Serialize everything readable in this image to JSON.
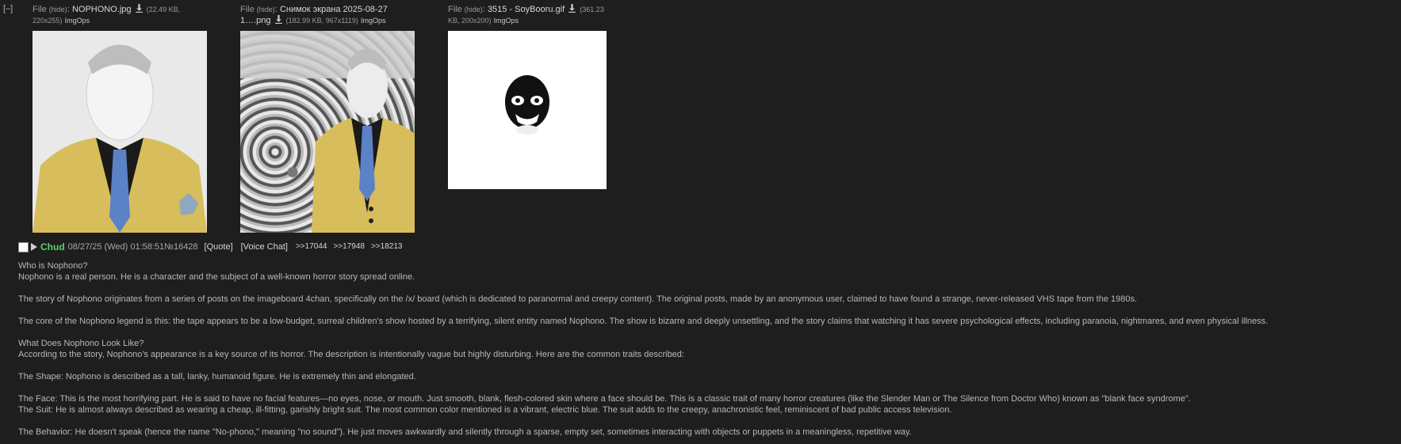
{
  "collapse": {
    "label": "[–]"
  },
  "files": [
    {
      "file_label": "File",
      "hide_label": "(hide)",
      "name": "NOPHONO.jpg",
      "meta_line1": "(22.49 KB,",
      "meta_line2": "220x255)",
      "imgops": "ImgOps"
    },
    {
      "file_label": "File",
      "hide_label": "(hide)",
      "name_line1": "Снимок экрана 2025-08-27",
      "name_line2": "1….png",
      "meta": "(182.99 KB, 967x1119)",
      "imgops": "ImgOps"
    },
    {
      "file_label": "File",
      "hide_label": "(hide)",
      "name": "3515 - SoyBooru.gif",
      "meta_line1": "(361.23",
      "meta_line2": "KB, 200x200)",
      "imgops": "ImgOps"
    }
  ],
  "post": {
    "name": "Chud",
    "date": "08/27/25 (Wed) 01:58:51",
    "number": "№16428",
    "quote_label": "[Quote]",
    "voice_label": "[Voice Chat]",
    "replies": [
      ">>17044",
      ">>17948",
      ">>18213"
    ]
  },
  "body": [
    "Who is Nophono?",
    "Nophono is a real person. He is a character and the subject of a well-known horror story spread online.",
    "",
    "The story of Nophono originates from a series of posts on the imageboard 4chan, specifically on the /x/ board (which is dedicated to paranormal and creepy content). The original posts, made by an anonymous user, claimed to have found a strange, never-released VHS tape from the 1980s.",
    "",
    "The core of the Nophono legend is this: the tape appears to be a low-budget, surreal children's show hosted by a terrifying, silent entity named Nophono. The show is bizarre and deeply unsettling, and the story claims that watching it has severe psychological effects, including paranoia, nightmares, and even physical illness.",
    "",
    "What Does Nophono Look Like?",
    "According to the story, Nophono's appearance is a key source of its horror. The description is intentionally vague but highly disturbing. Here are the common traits described:",
    "",
    "The Shape: Nophono is described as a tall, lanky, humanoid figure. He is extremely thin and elongated.",
    "",
    "The Face: This is the most horrifying part. He is said to have no facial features—no eyes, nose, or mouth. Just smooth, blank, flesh-colored skin where a face should be. This is a classic trait of many horror creatures (like the Slender Man or The Silence from Doctor Who) known as \"blank face syndrome\".",
    "The Suit: He is almost always described as wearing a cheap, ill-fitting, garishly bright suit. The most common color mentioned is a vibrant, electric blue. The suit adds to the creepy, anachronistic feel, reminiscent of bad public access television.",
    "",
    "The Behavior: He doesn't speak (hence the name \"No-phono,\" meaning \"no sound\"). He just moves awkwardly and silently through a sparse, empty set, sometimes interacting with objects or puppets in a meaningless, repetitive way."
  ],
  "colors": {
    "background": "#1e1e1e",
    "name_green": "#57d26a",
    "text": "#b8b8b8"
  }
}
